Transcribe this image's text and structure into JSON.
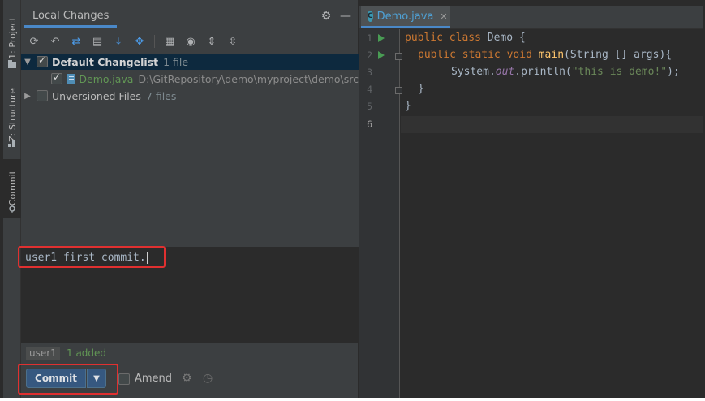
{
  "sidebar": {
    "tabs": [
      {
        "label": "1: Project",
        "icon": "folder-icon"
      },
      {
        "label": "Z: Structure",
        "icon": "structure-icon"
      },
      {
        "label": "Commit",
        "icon": "commit-icon"
      }
    ]
  },
  "commit_panel": {
    "tab_label": "Local Changes",
    "changelist": {
      "name": "Default Changelist",
      "count": "1 file"
    },
    "file": {
      "name": "Demo.java",
      "path": "D:\\GitRepository\\demo\\myproject\\demo\\src"
    },
    "unversioned": {
      "name": "Unversioned Files",
      "count": "7 files"
    },
    "message": "user1 first commit.",
    "status": {
      "user": "user1",
      "summary": "1 added"
    },
    "commit_label": "Commit",
    "amend_label": "Amend"
  },
  "editor": {
    "tab_label": "Demo.java",
    "line_numbers": [
      "1",
      "2",
      "3",
      "4",
      "5",
      "6"
    ],
    "code": {
      "l1_kw1": "public",
      "l1_kw2": "class",
      "l1_rest": "Demo {",
      "l2_kw1": "public",
      "l2_kw2": "static",
      "l2_kw3": "void",
      "l2_fn": "main",
      "l2_rest": "(String [] args){",
      "l3_a": "System.",
      "l3_out": "out",
      "l3_b": ".println(",
      "l3_str": "\"this is demo!\"",
      "l3_c": ");",
      "l4": "}",
      "l5": "}"
    }
  },
  "colors": {
    "accent": "#4a88c7",
    "highlight_box": "#e03030",
    "added": "#629755",
    "keyword": "#cc7832",
    "string": "#6a8759"
  }
}
